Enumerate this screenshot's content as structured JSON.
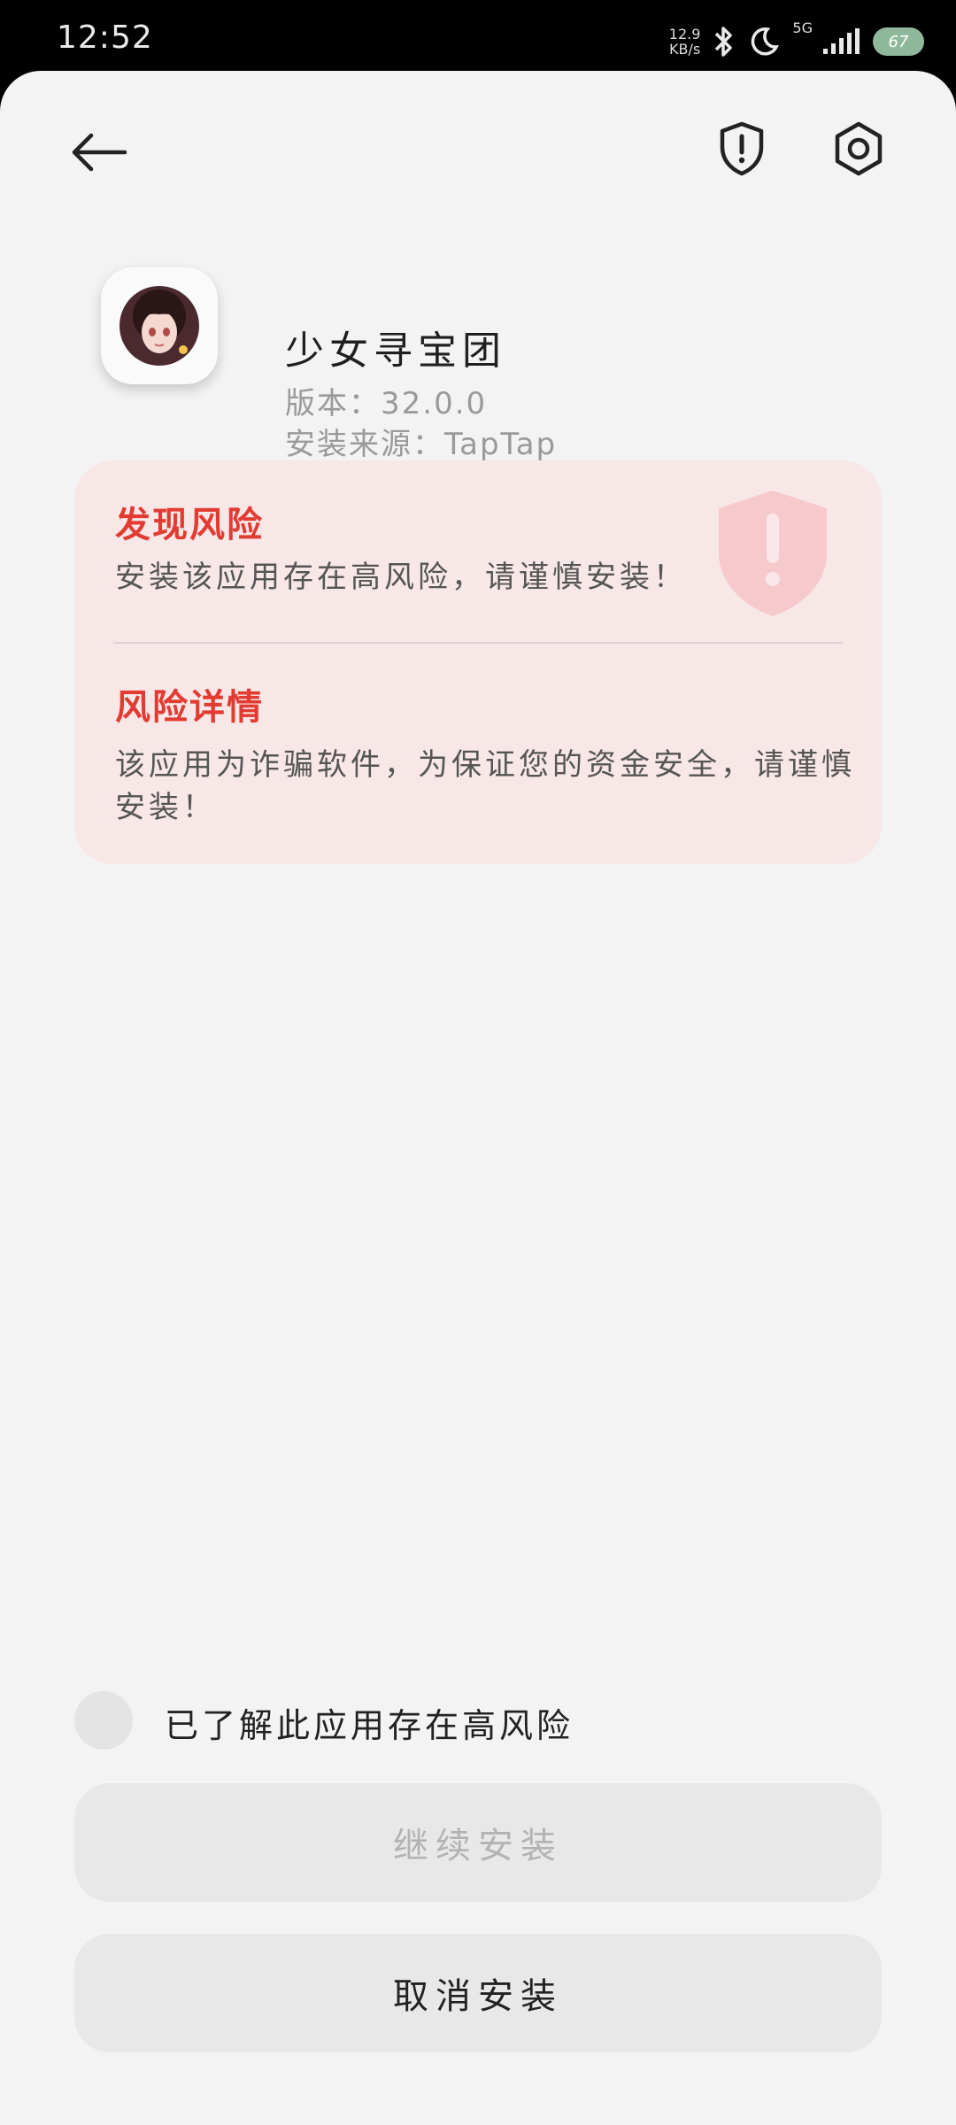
{
  "status_bar": {
    "time": "12:52",
    "net_speed_value": "12.9",
    "net_speed_unit": "KB/s",
    "network": "5G",
    "battery": "67",
    "icons": [
      "bluetooth-icon",
      "moon-icon",
      "signal-icon",
      "battery-icon"
    ]
  },
  "header": {
    "icons": [
      "back-arrow-icon",
      "shield-alert-icon",
      "settings-hex-icon"
    ]
  },
  "app": {
    "name": "少女寻宝团",
    "version": "版本：32.0.0",
    "source": "安装来源：TapTap"
  },
  "risk": {
    "found_title": "发现风险",
    "found_text": "安装该应用存在高风险，请谨慎安装！",
    "details_title": "风险详情",
    "details_text": "该应用为诈骗软件，为保证您的资金安全，请谨慎安装！",
    "accent_color": "#e13b32",
    "card_color": "#f8e7e7"
  },
  "acknowledge": {
    "label": "已了解此应用存在高风险",
    "checked": false
  },
  "buttons": {
    "continue": "继续安装",
    "cancel": "取消安装"
  }
}
